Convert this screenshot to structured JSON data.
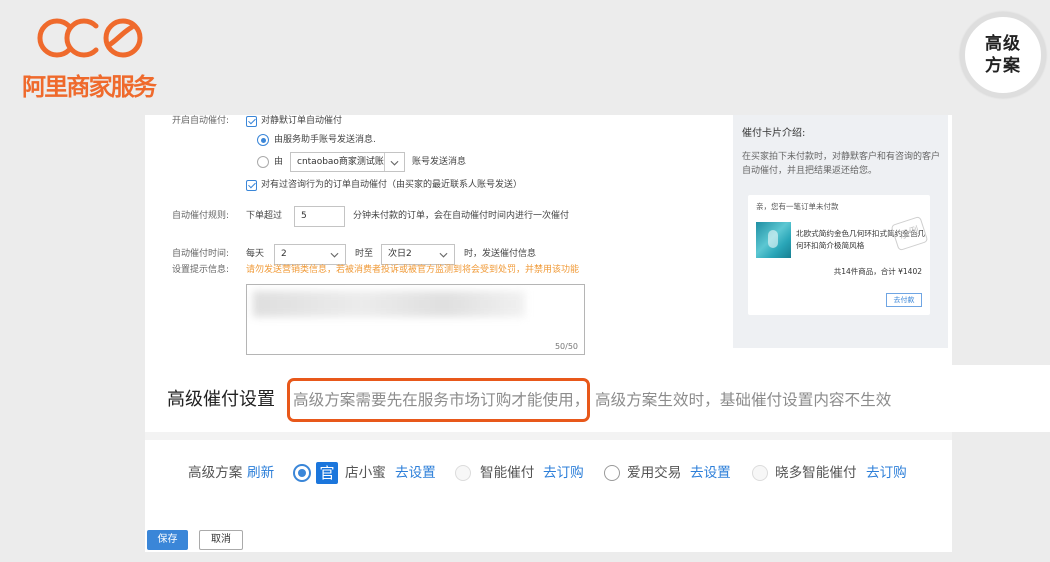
{
  "brand": {
    "logo_text": "阿里商家服务"
  },
  "badge": {
    "line1": "高级",
    "line2": "方案"
  },
  "form": {
    "auto_urge": {
      "label": "开启自动催付:",
      "silent_orders": {
        "label": "对静默订单自动催付",
        "checked": true
      },
      "sender_service": {
        "label": "由服务助手账号发送消息.",
        "selected": true
      },
      "sender_account": {
        "prefix": "由",
        "account": "cntaobao商家测试账号",
        "suffix": "账号发送消息",
        "selected": false
      },
      "consult_orders": {
        "label": "对有过咨询行为的订单自动催付（由买家的最近联系人账号发送）",
        "checked": true
      }
    },
    "rule": {
      "label": "自动催付规则:",
      "prefix": "下单超过",
      "minutes": "5",
      "suffix": "分钟未付款的订单，会在自动催付时间内进行一次催付"
    },
    "time": {
      "label": "自动催付时间:",
      "prefix": "每天",
      "start": "2",
      "middle": "时至",
      "end": "次日2",
      "suffix": "时，发送催付信息"
    },
    "message": {
      "label": "设置提示信息:",
      "warning": "请勿发送营销类信息，若被消费者投诉或被官方监测到将会受到处罚，并禁用该功能",
      "counter": "50/50"
    }
  },
  "card_intro": {
    "title": "催付卡片介绍:",
    "description": "在买家拍下未付款时，对静默客户和有咨询的客户自动催付，并且把结果返还给您。",
    "preview": {
      "greeting": "亲，您有一笔订单未付款",
      "product_title": "北欧式简约金色几何环扣式简约金色几何环扣简介极简风格",
      "stamp": "示例",
      "summary": "共14件商品，合计 ¥1402",
      "pay_button": "去付款"
    }
  },
  "advanced": {
    "heading": "高级催付设置",
    "notice_highlighted": "高级方案需要先在服务市场订购才能使用，",
    "notice_rest": "高级方案生效时，基础催付设置内容不生效",
    "plans_label": "高级方案",
    "refresh_link": "刷新",
    "plans": [
      {
        "official_badge": "官",
        "name": "店小蜜",
        "action": "去设置",
        "selected": true,
        "disabled": false
      },
      {
        "name": "智能催付",
        "action": "去订购",
        "selected": false,
        "disabled": true
      },
      {
        "name": "爱用交易",
        "action": "去设置",
        "selected": false,
        "disabled": false
      },
      {
        "name": "晓多智能催付",
        "action": "去订购",
        "selected": false,
        "disabled": true
      }
    ]
  },
  "actions": {
    "save": "保存",
    "cancel": "取消"
  },
  "colors": {
    "primary": "#3a86d8",
    "link": "#2d7fd9",
    "warning": "#f09a37",
    "highlight": "#e8581a",
    "brand": "#ef6a2c"
  }
}
